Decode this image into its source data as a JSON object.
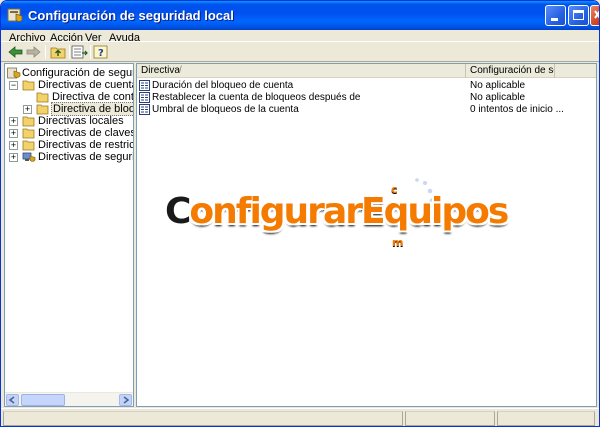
{
  "window": {
    "title": "Configuración de seguridad local"
  },
  "menu": {
    "items": [
      "Archivo",
      "Acción",
      "Ver",
      "Ayuda"
    ]
  },
  "toolbar": {
    "buttons": [
      "back-icon",
      "forward-icon",
      "up-folder-icon",
      "export-list-icon",
      "help-icon"
    ]
  },
  "tree": {
    "root": "Configuración de seguridad",
    "items": [
      {
        "label": "Directivas de cuenta",
        "expanded": true
      },
      {
        "label": "Directiva de contraseñ",
        "child": true
      },
      {
        "label": "Directiva de bloqueo de",
        "child": true,
        "selected": true
      },
      {
        "label": "Directivas locales"
      },
      {
        "label": "Directivas de claves pública"
      },
      {
        "label": "Directivas de restricción de"
      },
      {
        "label": "Directivas de seguridad IP"
      }
    ]
  },
  "list": {
    "columns": [
      "Directiva",
      "Configuración de se..."
    ],
    "rows": [
      {
        "name": "Duración del bloqueo de cuenta",
        "value": "No aplicable"
      },
      {
        "name": "Restablecer la cuenta de bloqueos después de",
        "value": "No aplicable"
      },
      {
        "name": "Umbral de bloqueos de la cuenta",
        "value": "0 intentos de inicio ..."
      }
    ]
  },
  "watermark": {
    "text_first": "C",
    "text_rest": "onfigurarEquipos",
    "dot_letters": [
      "c",
      "m"
    ]
  },
  "colors": {
    "titlebar": "#0054E3",
    "watermark_orange": "#F47A00",
    "selection": "#ECE9D8"
  }
}
